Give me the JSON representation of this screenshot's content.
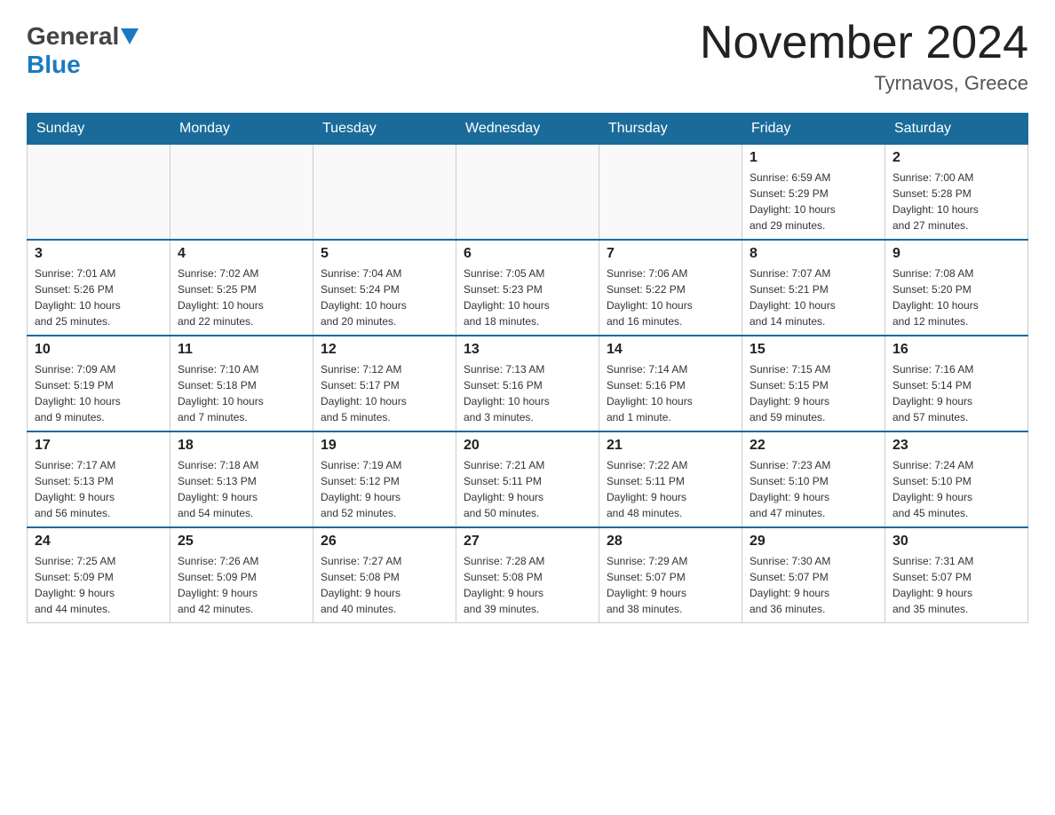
{
  "header": {
    "logo_general": "General",
    "logo_blue": "Blue",
    "title": "November 2024",
    "subtitle": "Tyrnavos, Greece"
  },
  "weekdays": [
    "Sunday",
    "Monday",
    "Tuesday",
    "Wednesday",
    "Thursday",
    "Friday",
    "Saturday"
  ],
  "weeks": [
    {
      "days": [
        {
          "num": "",
          "info": ""
        },
        {
          "num": "",
          "info": ""
        },
        {
          "num": "",
          "info": ""
        },
        {
          "num": "",
          "info": ""
        },
        {
          "num": "",
          "info": ""
        },
        {
          "num": "1",
          "info": "Sunrise: 6:59 AM\nSunset: 5:29 PM\nDaylight: 10 hours\nand 29 minutes."
        },
        {
          "num": "2",
          "info": "Sunrise: 7:00 AM\nSunset: 5:28 PM\nDaylight: 10 hours\nand 27 minutes."
        }
      ]
    },
    {
      "days": [
        {
          "num": "3",
          "info": "Sunrise: 7:01 AM\nSunset: 5:26 PM\nDaylight: 10 hours\nand 25 minutes."
        },
        {
          "num": "4",
          "info": "Sunrise: 7:02 AM\nSunset: 5:25 PM\nDaylight: 10 hours\nand 22 minutes."
        },
        {
          "num": "5",
          "info": "Sunrise: 7:04 AM\nSunset: 5:24 PM\nDaylight: 10 hours\nand 20 minutes."
        },
        {
          "num": "6",
          "info": "Sunrise: 7:05 AM\nSunset: 5:23 PM\nDaylight: 10 hours\nand 18 minutes."
        },
        {
          "num": "7",
          "info": "Sunrise: 7:06 AM\nSunset: 5:22 PM\nDaylight: 10 hours\nand 16 minutes."
        },
        {
          "num": "8",
          "info": "Sunrise: 7:07 AM\nSunset: 5:21 PM\nDaylight: 10 hours\nand 14 minutes."
        },
        {
          "num": "9",
          "info": "Sunrise: 7:08 AM\nSunset: 5:20 PM\nDaylight: 10 hours\nand 12 minutes."
        }
      ]
    },
    {
      "days": [
        {
          "num": "10",
          "info": "Sunrise: 7:09 AM\nSunset: 5:19 PM\nDaylight: 10 hours\nand 9 minutes."
        },
        {
          "num": "11",
          "info": "Sunrise: 7:10 AM\nSunset: 5:18 PM\nDaylight: 10 hours\nand 7 minutes."
        },
        {
          "num": "12",
          "info": "Sunrise: 7:12 AM\nSunset: 5:17 PM\nDaylight: 10 hours\nand 5 minutes."
        },
        {
          "num": "13",
          "info": "Sunrise: 7:13 AM\nSunset: 5:16 PM\nDaylight: 10 hours\nand 3 minutes."
        },
        {
          "num": "14",
          "info": "Sunrise: 7:14 AM\nSunset: 5:16 PM\nDaylight: 10 hours\nand 1 minute."
        },
        {
          "num": "15",
          "info": "Sunrise: 7:15 AM\nSunset: 5:15 PM\nDaylight: 9 hours\nand 59 minutes."
        },
        {
          "num": "16",
          "info": "Sunrise: 7:16 AM\nSunset: 5:14 PM\nDaylight: 9 hours\nand 57 minutes."
        }
      ]
    },
    {
      "days": [
        {
          "num": "17",
          "info": "Sunrise: 7:17 AM\nSunset: 5:13 PM\nDaylight: 9 hours\nand 56 minutes."
        },
        {
          "num": "18",
          "info": "Sunrise: 7:18 AM\nSunset: 5:13 PM\nDaylight: 9 hours\nand 54 minutes."
        },
        {
          "num": "19",
          "info": "Sunrise: 7:19 AM\nSunset: 5:12 PM\nDaylight: 9 hours\nand 52 minutes."
        },
        {
          "num": "20",
          "info": "Sunrise: 7:21 AM\nSunset: 5:11 PM\nDaylight: 9 hours\nand 50 minutes."
        },
        {
          "num": "21",
          "info": "Sunrise: 7:22 AM\nSunset: 5:11 PM\nDaylight: 9 hours\nand 48 minutes."
        },
        {
          "num": "22",
          "info": "Sunrise: 7:23 AM\nSunset: 5:10 PM\nDaylight: 9 hours\nand 47 minutes."
        },
        {
          "num": "23",
          "info": "Sunrise: 7:24 AM\nSunset: 5:10 PM\nDaylight: 9 hours\nand 45 minutes."
        }
      ]
    },
    {
      "days": [
        {
          "num": "24",
          "info": "Sunrise: 7:25 AM\nSunset: 5:09 PM\nDaylight: 9 hours\nand 44 minutes."
        },
        {
          "num": "25",
          "info": "Sunrise: 7:26 AM\nSunset: 5:09 PM\nDaylight: 9 hours\nand 42 minutes."
        },
        {
          "num": "26",
          "info": "Sunrise: 7:27 AM\nSunset: 5:08 PM\nDaylight: 9 hours\nand 40 minutes."
        },
        {
          "num": "27",
          "info": "Sunrise: 7:28 AM\nSunset: 5:08 PM\nDaylight: 9 hours\nand 39 minutes."
        },
        {
          "num": "28",
          "info": "Sunrise: 7:29 AM\nSunset: 5:07 PM\nDaylight: 9 hours\nand 38 minutes."
        },
        {
          "num": "29",
          "info": "Sunrise: 7:30 AM\nSunset: 5:07 PM\nDaylight: 9 hours\nand 36 minutes."
        },
        {
          "num": "30",
          "info": "Sunrise: 7:31 AM\nSunset: 5:07 PM\nDaylight: 9 hours\nand 35 minutes."
        }
      ]
    }
  ]
}
